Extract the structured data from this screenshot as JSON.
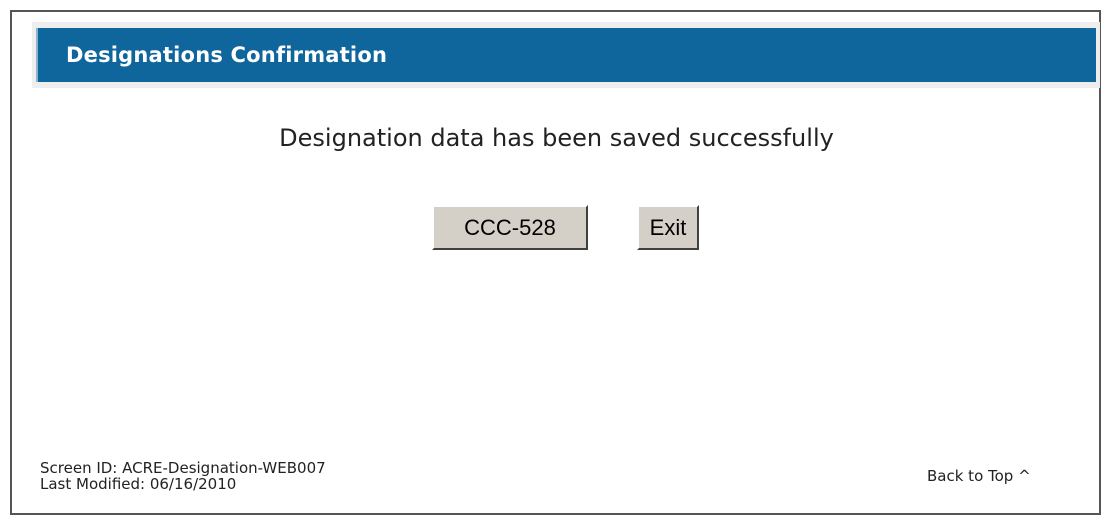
{
  "header": {
    "title": "Designations Confirmation"
  },
  "message": "Designation data has been saved successfully",
  "buttons": {
    "ccc528_label": "CCC-528",
    "exit_label": "Exit"
  },
  "footer": {
    "screen_id": "Screen ID: ACRE-Designation-WEB007",
    "last_modified": "Last Modified: 06/16/2010",
    "back_to_top": "Back to Top ^"
  },
  "colors": {
    "header_bar": "#0e669c",
    "header_text": "#ffffff",
    "button_face": "#d4d0c8",
    "frame_border": "#555555"
  }
}
